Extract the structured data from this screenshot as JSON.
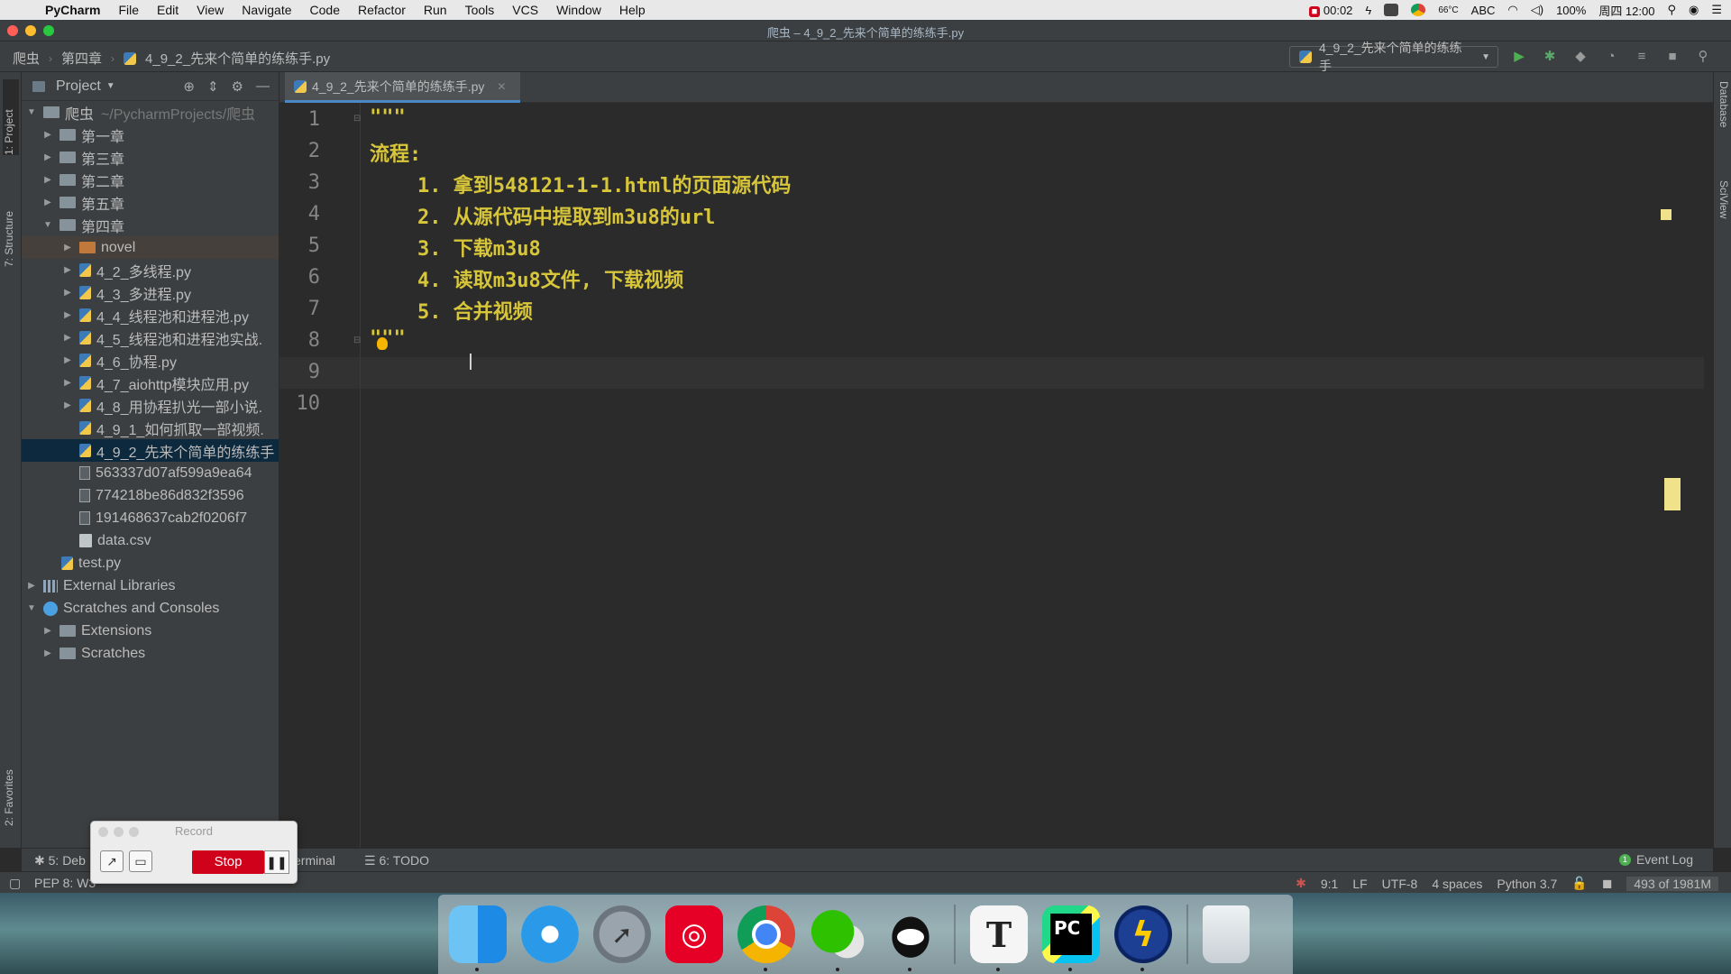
{
  "menubar": {
    "app_name": "PyCharm",
    "items": [
      "File",
      "Edit",
      "View",
      "Navigate",
      "Code",
      "Refactor",
      "Run",
      "Tools",
      "VCS",
      "Window",
      "Help"
    ],
    "recording_time": "00:02",
    "temp": "66°C",
    "input_method": "ABC",
    "battery": "100%",
    "clock": "周四 12:00"
  },
  "window": {
    "title": "爬虫 – 4_9_2_先来个简单的练练手.py"
  },
  "navbar": {
    "breadcrumb": [
      "爬虫",
      "第四章",
      "4_9_2_先来个简单的练练手.py"
    ],
    "run_config": "4_9_2_先来个简单的练练手"
  },
  "left_strip": {
    "project_tab": "1: Project",
    "structure_tab": "7: Structure",
    "favorites_tab": "2: Favorites"
  },
  "right_strip": {
    "database_tab": "Database",
    "sciview_tab": "SciView"
  },
  "project_panel": {
    "title": "Project",
    "root_name": "爬虫",
    "root_path": "~/PycharmProjects/爬虫",
    "rows": [
      {
        "label": "第一章"
      },
      {
        "label": "第三章"
      },
      {
        "label": "第二章"
      },
      {
        "label": "第五章"
      },
      {
        "label": "第四章"
      },
      {
        "label": "novel"
      },
      {
        "label": "4_2_多线程.py"
      },
      {
        "label": "4_3_多进程.py"
      },
      {
        "label": "4_4_线程池和进程池.py"
      },
      {
        "label": "4_5_线程池和进程池实战."
      },
      {
        "label": "4_6_协程.py"
      },
      {
        "label": "4_7_aiohttp模块应用.py"
      },
      {
        "label": "4_8_用协程扒光一部小说."
      },
      {
        "label": "4_9_1_如何抓取一部视频."
      },
      {
        "label": "4_9_2_先来个简单的练练手"
      },
      {
        "label": "563337d07af599a9ea64"
      },
      {
        "label": "774218be86d832f3596"
      },
      {
        "label": "191468637cab2f0206f7"
      },
      {
        "label": "data.csv"
      },
      {
        "label": "test.py"
      },
      {
        "label": "External Libraries"
      },
      {
        "label": "Scratches and Consoles"
      },
      {
        "label": "Extensions"
      },
      {
        "label": "Scratches"
      }
    ]
  },
  "editor": {
    "tab_label": "4_9_2_先来个简单的练练手.py",
    "line_numbers": [
      "1",
      "2",
      "3",
      "4",
      "5",
      "6",
      "7",
      "8",
      "9",
      "10"
    ],
    "lines": [
      "\"\"\"",
      "流程:",
      "    1. 拿到548121-1-1.html的页面源代码",
      "    2. 从源代码中提取到m3u8的url",
      "    3. 下载m3u8",
      "    4. 读取m3u8文件, 下载视频",
      "    5. 合并视频",
      "\"\"\"",
      "",
      ""
    ]
  },
  "bottom_bar": {
    "debug": "5: Deb",
    "terminal": "erminal",
    "todo": "6: TODO",
    "event_log": "Event Log",
    "event_count": "1"
  },
  "status_bar": {
    "message": "PEP 8: W3",
    "position": "9:1",
    "line_sep": "LF",
    "encoding": "UTF-8",
    "indent": "4 spaces",
    "interpreter": "Python 3.7",
    "memory": "493 of 1981M"
  },
  "recorder": {
    "title": "Record",
    "stop_label": "Stop"
  },
  "dock": {
    "typora_letter": "T",
    "pycharm_letters": "PC"
  }
}
